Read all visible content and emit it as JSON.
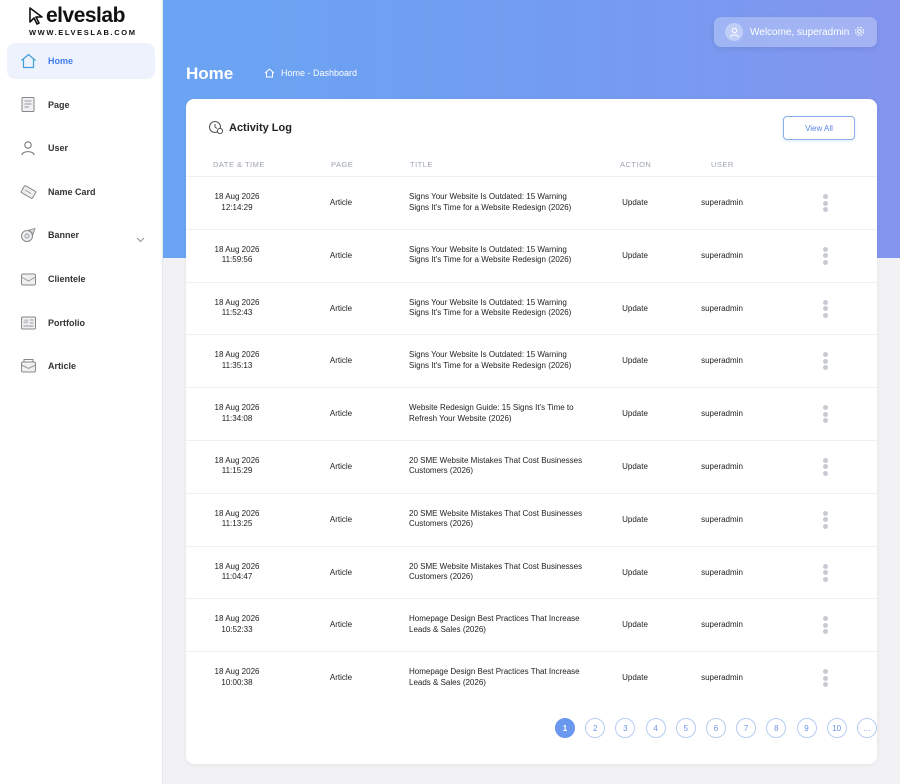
{
  "brand": {
    "name": "elveslab",
    "url": "WWW.ELVESLAB.COM"
  },
  "sidebar": {
    "items": [
      {
        "label": "Home",
        "icon": "home-icon"
      },
      {
        "label": "Page",
        "icon": "page-icon"
      },
      {
        "label": "User",
        "icon": "user-icon"
      },
      {
        "label": "Name Card",
        "icon": "name-card-icon"
      },
      {
        "label": "Banner",
        "icon": "banner-icon"
      },
      {
        "label": "Clientele",
        "icon": "clientele-icon"
      },
      {
        "label": "Portfolio",
        "icon": "portfolio-icon"
      },
      {
        "label": "Article",
        "icon": "article-icon"
      }
    ]
  },
  "header": {
    "title": "Home",
    "breadcrumb": "Home - Dashboard",
    "welcome": "Welcome, superadmin"
  },
  "activity": {
    "title": "Activity Log",
    "view_all": "View All",
    "columns": [
      "DATE & TIME",
      "PAGE",
      "TITLE",
      "ACTION",
      "USER"
    ],
    "rows": [
      {
        "date": "18 Aug 2026",
        "time": "12:14:29",
        "page": "Article",
        "title": "Signs Your Website Is Outdated: 15 Warning Signs It's Time for a Website Redesign (2026)",
        "action": "Update",
        "user": "superadmin"
      },
      {
        "date": "18 Aug 2026",
        "time": "11:59:56",
        "page": "Article",
        "title": "Signs Your Website Is Outdated: 15 Warning Signs It's Time for a Website Redesign (2026)",
        "action": "Update",
        "user": "superadmin"
      },
      {
        "date": "18 Aug 2026",
        "time": "11:52:43",
        "page": "Article",
        "title": "Signs Your Website Is Outdated: 15 Warning Signs It's Time for a Website Redesign (2026)",
        "action": "Update",
        "user": "superadmin"
      },
      {
        "date": "18 Aug 2026",
        "time": "11:35:13",
        "page": "Article",
        "title": "Signs Your Website Is Outdated: 15 Warning Signs It's Time for a Website Redesign (2026)",
        "action": "Update",
        "user": "superadmin"
      },
      {
        "date": "18 Aug 2026",
        "time": "11:34:08",
        "page": "Article",
        "title": "Website Redesign Guide: 15 Signs It's Time to Refresh Your Website (2026)",
        "action": "Update",
        "user": "superadmin"
      },
      {
        "date": "18 Aug 2026",
        "time": "11:15:29",
        "page": "Article",
        "title": "20 SME Website Mistakes That Cost Businesses Customers (2026)",
        "action": "Update",
        "user": "superadmin"
      },
      {
        "date": "18 Aug 2026",
        "time": "11:13:25",
        "page": "Article",
        "title": "20 SME Website Mistakes That Cost Businesses Customers (2026)",
        "action": "Update",
        "user": "superadmin"
      },
      {
        "date": "18 Aug 2026",
        "time": "11:04:47",
        "page": "Article",
        "title": "20 SME Website Mistakes That Cost Businesses Customers (2026)",
        "action": "Update",
        "user": "superadmin"
      },
      {
        "date": "18 Aug 2026",
        "time": "10:52:33",
        "page": "Article",
        "title": "Homepage Design Best Practices That Increase Leads & Sales (2026)",
        "action": "Update",
        "user": "superadmin"
      },
      {
        "date": "18 Aug 2026",
        "time": "10:00:38",
        "page": "Article",
        "title": "Homepage Design Best Practices That Increase Leads & Sales (2026)",
        "action": "Update",
        "user": "superadmin"
      }
    ]
  },
  "pagination": {
    "pages": [
      "1",
      "2",
      "3",
      "4",
      "5",
      "6",
      "7",
      "8",
      "9",
      "10",
      "..."
    ],
    "current": "1"
  },
  "colors": {
    "accent": "#3f7cf0",
    "gradient_start": "#6aa4f2",
    "gradient_end": "#8395ef"
  }
}
